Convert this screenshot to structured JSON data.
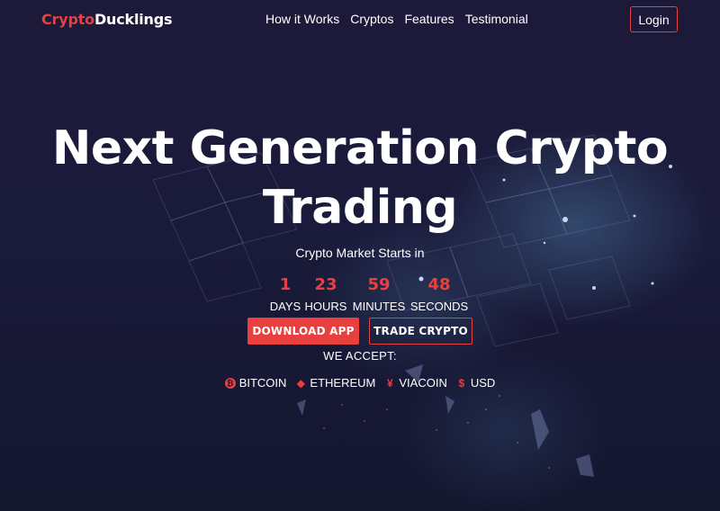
{
  "nav": {
    "logo_accent": "Crypto",
    "logo_rest": "Ducklings",
    "links": [
      "How it Works",
      "Cryptos",
      "Features",
      "Testimonial"
    ],
    "login_label": "Login"
  },
  "hero": {
    "headline_line1": "Next Generation Crypto",
    "headline_line2": "Trading",
    "subtitle": "Crypto Market Starts in"
  },
  "countdown": {
    "days": "1",
    "days_label": "DAYS",
    "hours": "23",
    "hours_label": "HOURS",
    "minutes": "59",
    "minutes_label": "MINUTES",
    "seconds": "48",
    "seconds_label": "SECONDS"
  },
  "actions": {
    "download_label": "DOWNLOAD APP",
    "trade_label": "TRADE CRYPTO"
  },
  "accept": {
    "label": "WE ACCEPT:",
    "coins": [
      {
        "name": "BITCOIN",
        "icon": "bitcoin-icon",
        "glyph": "₿"
      },
      {
        "name": "ETHEREUM",
        "icon": "ethereum-icon",
        "glyph": "◆"
      },
      {
        "name": "VIACOIN",
        "icon": "viacoin-icon",
        "glyph": "¥"
      },
      {
        "name": "USD",
        "icon": "dollar-icon",
        "glyph": "$"
      }
    ]
  },
  "colors": {
    "accent": "#e8403f",
    "background": "#1c1838",
    "text": "#ffffff"
  }
}
